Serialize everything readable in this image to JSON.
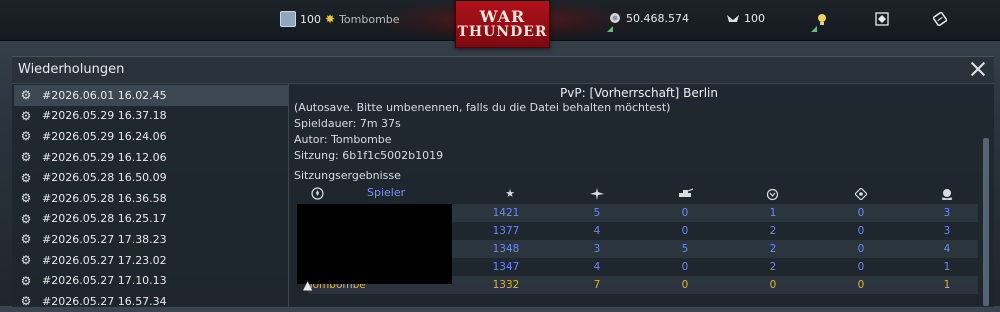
{
  "topbar": {
    "level": "100",
    "username": "Tombombe",
    "logo_line1": "WAR",
    "logo_line2": "THUNDER",
    "silver_lions": "50.468.574",
    "golden_eagles": "100"
  },
  "window": {
    "title": "Wiederholungen"
  },
  "replays": [
    "#2026.06.01 16.02.45",
    "#2026.05.29 16.37.18",
    "#2026.05.29 16.24.06",
    "#2026.05.29 16.12.06",
    "#2026.05.28 16.50.09",
    "#2026.05.28 16.36.58",
    "#2026.05.28 16.25.17",
    "#2026.05.27 17.38.23",
    "#2026.05.27 17.23.02",
    "#2026.05.27 17.10.13",
    "#2026.05.27 16.57.34"
  ],
  "detail": {
    "mission": "PvP: [Vorherrschaft] Berlin",
    "autosave_note": "(Autosave. Bitte umbenennen, falls du die Datei behalten möchtest)",
    "duration": "Spieldauer: 7m 37s",
    "author": "Autor: Tombombe",
    "session": "Sitzung: 6b1f1c5002b1019",
    "results_label": "Sitzungsergebnisse",
    "player_header": "Spieler",
    "column_icons": [
      "star-icon",
      "plane-icon",
      "ground-kill-icon",
      "assist-icon",
      "capture-icon",
      "death-icon"
    ],
    "rows": [
      {
        "player": "",
        "score": "1421",
        "air": "5",
        "ground": "0",
        "assists": "1",
        "captures": "0",
        "deaths": "3"
      },
      {
        "player": "",
        "score": "1377",
        "air": "4",
        "ground": "0",
        "assists": "2",
        "captures": "0",
        "deaths": "3"
      },
      {
        "player": "",
        "score": "1348",
        "air": "3",
        "ground": "5",
        "assists": "2",
        "captures": "0",
        "deaths": "4"
      },
      {
        "player": "",
        "score": "1347",
        "air": "4",
        "ground": "0",
        "assists": "2",
        "captures": "0",
        "deaths": "1"
      },
      {
        "player": "Tombombe",
        "score": "1332",
        "air": "7",
        "ground": "0",
        "assists": "0",
        "captures": "0",
        "deaths": "1"
      }
    ]
  },
  "colors": {
    "accent_blue": "#6f86ff",
    "self_gold": "#e2b23a",
    "logo_red": "#b0121a"
  }
}
